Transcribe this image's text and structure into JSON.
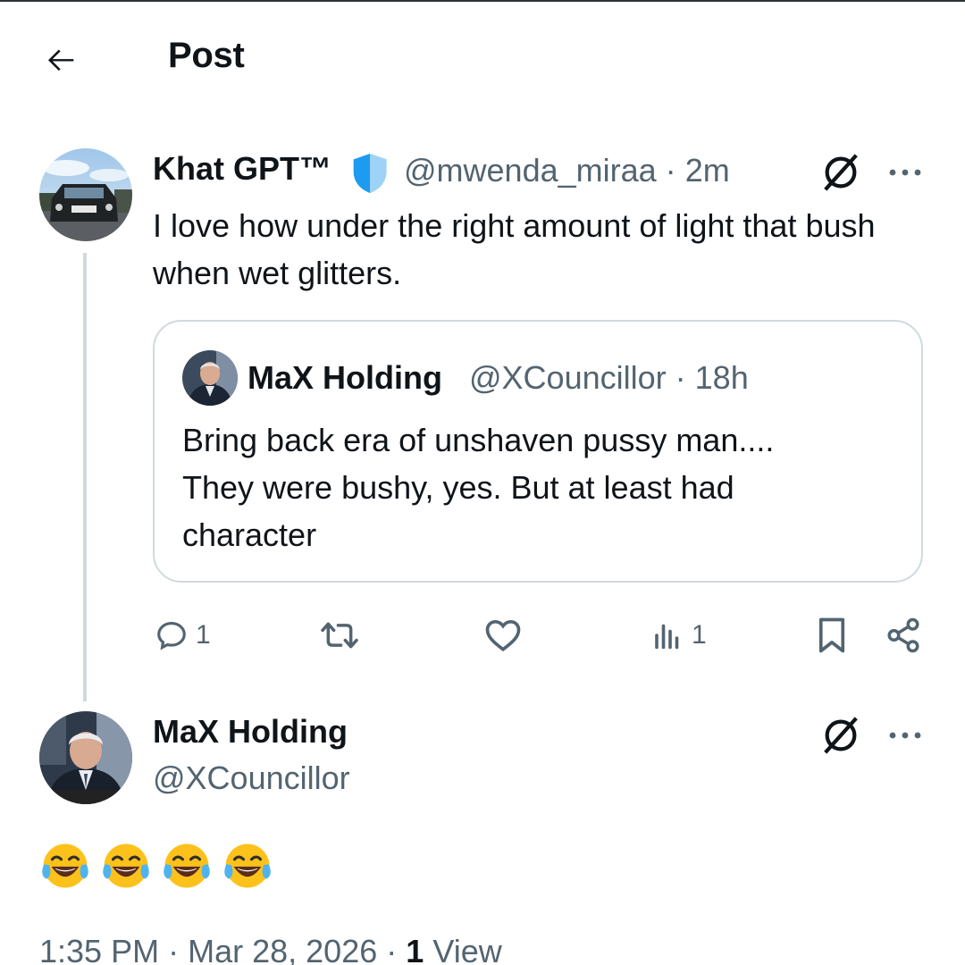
{
  "header": {
    "title": "Post",
    "back_icon": "arrow-left-icon"
  },
  "tweet": {
    "display_name": "Khat GPT™",
    "badge_icon": "blue-shield-icon",
    "badge_color": "#1d9bf0",
    "handle": "@mwenda_miraa",
    "separator": "·",
    "time": "2m",
    "text": "I love how under the right amount of light that bush when wet glitters."
  },
  "quote": {
    "display_name": "MaX Holding",
    "handle": "@XCouncillor",
    "separator": "·",
    "time": "18h",
    "text_lines": [
      "Bring back era of unshaven pussy man....",
      "They were bushy, yes. But at least had",
      "character"
    ]
  },
  "actions": {
    "replies": "1",
    "retweets": "",
    "likes": "",
    "views": "1"
  },
  "reply": {
    "display_name": "MaX Holding",
    "handle": "@XCouncillor",
    "emoji_count": 4,
    "emoji_name": "face-with-tears-of-joy"
  },
  "footer": {
    "time": "1:35 PM",
    "separator1": "·",
    "date": "Mar 28, 2026",
    "separator2": "·",
    "views_count": "1",
    "views_label": "View"
  },
  "colors": {
    "text": "#0f1419",
    "secondary": "#536471",
    "border": "#cfd9de",
    "accent": "#1d9bf0"
  }
}
